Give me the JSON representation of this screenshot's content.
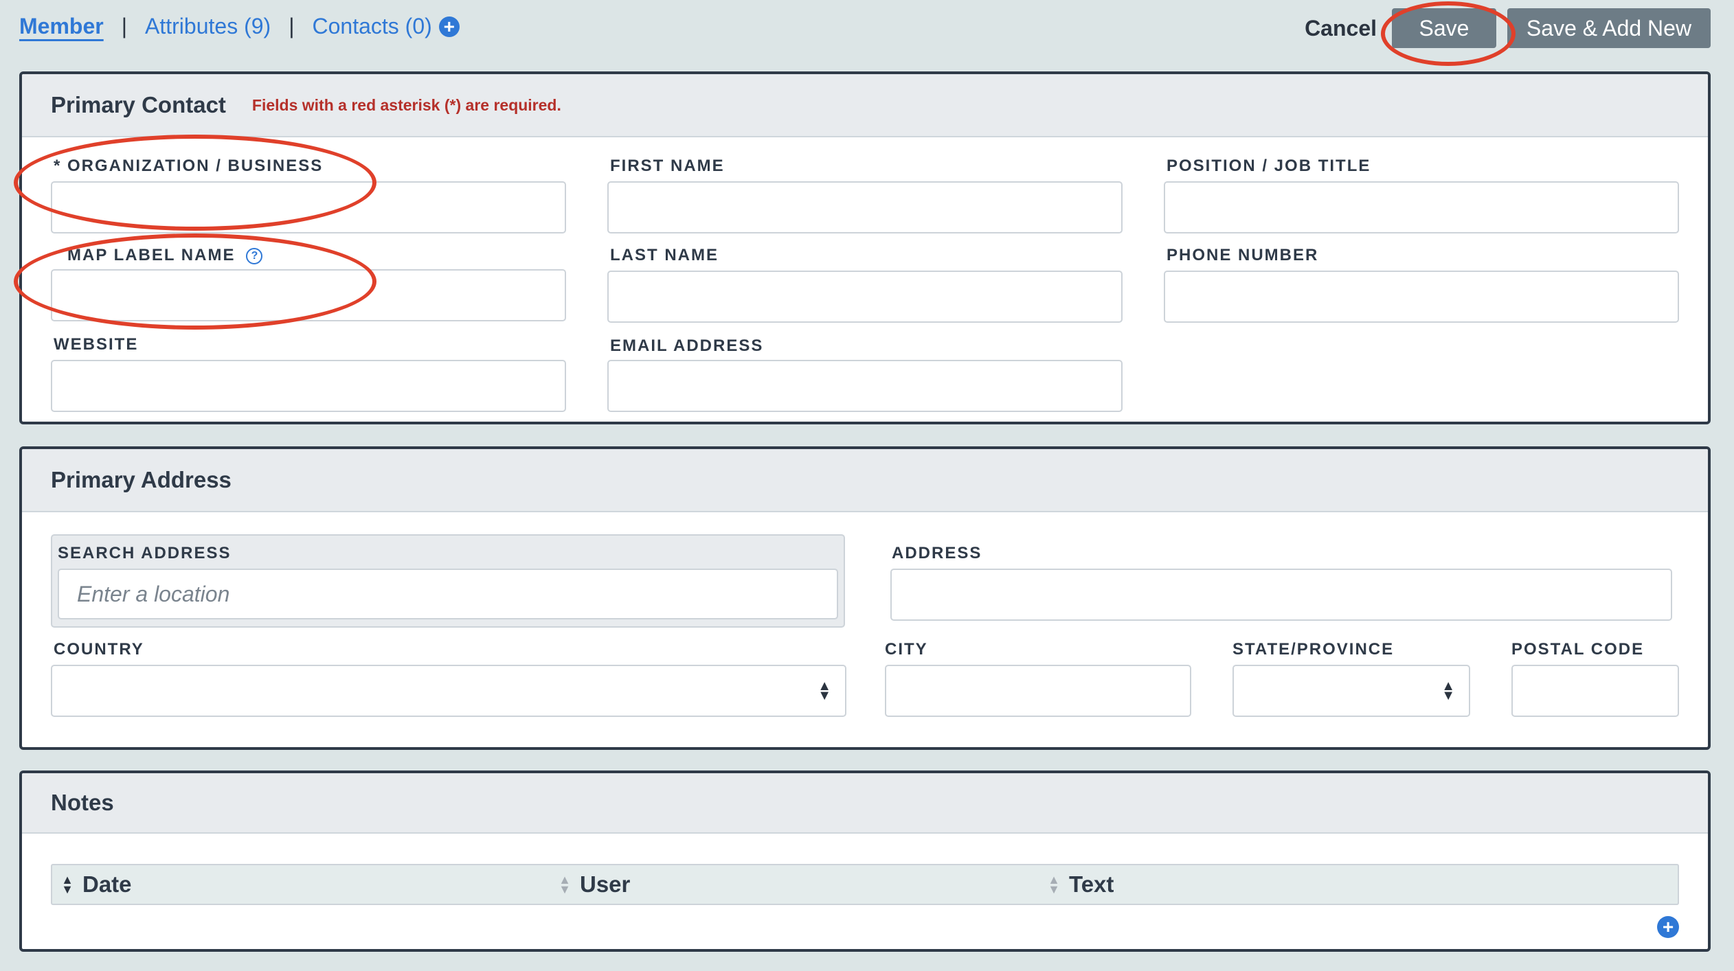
{
  "tabs": {
    "member": "Member",
    "attributes": "Attributes (9)",
    "contacts": "Contacts (0)",
    "separator": "|",
    "add_contact_symbol": "+"
  },
  "actions": {
    "cancel": "Cancel",
    "save": "Save",
    "save_add_new": "Save & Add New"
  },
  "primary_contact": {
    "title": "Primary Contact",
    "required_note": "Fields with a red asterisk (*) are required.",
    "fields": {
      "organization": {
        "label": "* ORGANIZATION / BUSINESS",
        "value": ""
      },
      "first_name": {
        "label": "FIRST NAME",
        "value": ""
      },
      "position": {
        "label": "POSITION / JOB TITLE",
        "value": ""
      },
      "map_label": {
        "label": "MAP LABEL NAME",
        "value": ""
      },
      "last_name": {
        "label": "LAST NAME",
        "value": ""
      },
      "phone": {
        "label": "PHONE NUMBER",
        "value": ""
      },
      "website": {
        "label": "WEBSITE",
        "value": ""
      },
      "email": {
        "label": "EMAIL ADDRESS",
        "value": ""
      }
    },
    "help_symbol": "?"
  },
  "primary_address": {
    "title": "Primary Address",
    "search": {
      "label": "SEARCH ADDRESS",
      "placeholder": "Enter a location"
    },
    "address": {
      "label": "ADDRESS",
      "value": ""
    },
    "country": {
      "label": "COUNTRY",
      "value": ""
    },
    "city": {
      "label": "CITY",
      "value": ""
    },
    "state": {
      "label": "STATE/PROVINCE",
      "value": ""
    },
    "postal": {
      "label": "POSTAL CODE",
      "value": ""
    }
  },
  "notes": {
    "title": "Notes",
    "columns": [
      "Date",
      "User",
      "Text"
    ],
    "add_symbol": "+"
  },
  "colors": {
    "link": "#2f78d6",
    "button": "#6d7c86",
    "annotation": "#e0402a",
    "required": "#b5302a"
  }
}
